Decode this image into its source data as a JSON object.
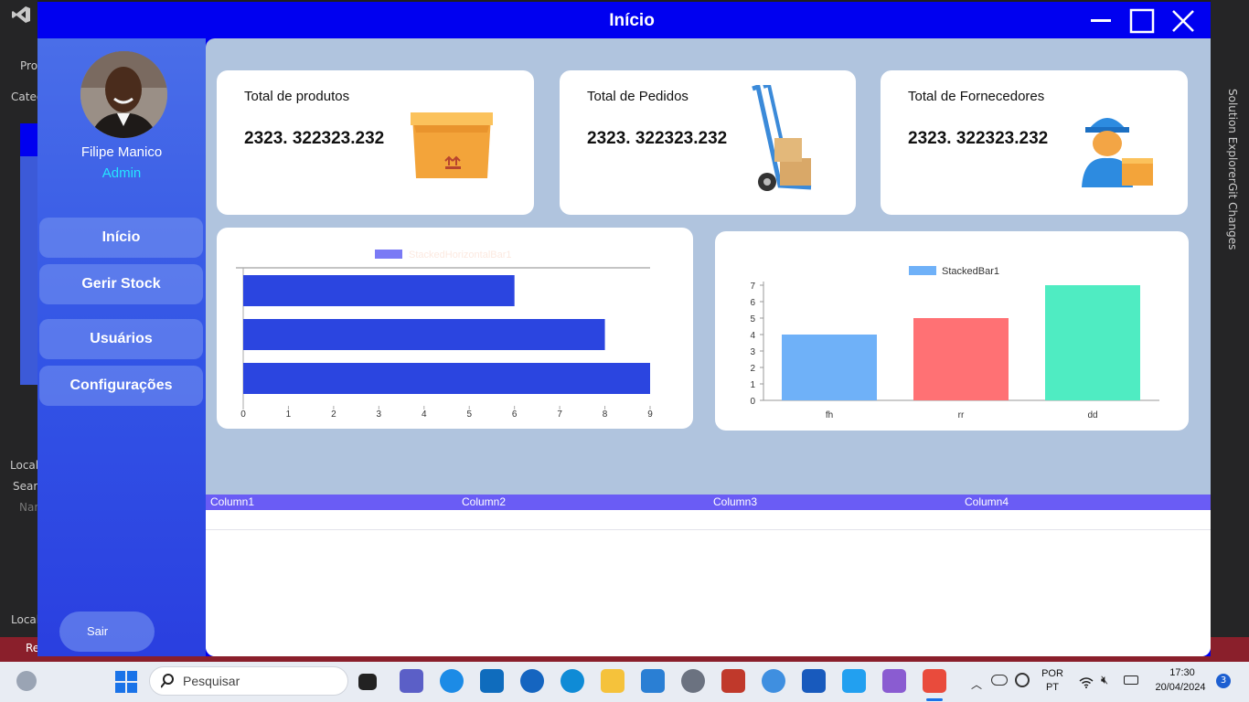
{
  "ide": {
    "left_labels": [
      "Pro",
      "Categ",
      "Locals",
      "Search",
      "Nam",
      "Locals",
      "Re"
    ],
    "right_labels": [
      "Solution Explorer",
      "Git Changes"
    ]
  },
  "window": {
    "title": "Início"
  },
  "sidebar": {
    "user_name": "Filipe Manico",
    "user_role": "Admin",
    "nav": [
      {
        "label": "Início"
      },
      {
        "label": "Gerir Stock"
      },
      {
        "label": "Usuários"
      },
      {
        "label": "Configurações"
      }
    ],
    "logout_label": "Sair"
  },
  "cards": [
    {
      "label": "Total de produtos",
      "value": "2323. 322323.232",
      "icon": "box-icon"
    },
    {
      "label": "Total de Pedidos",
      "value": "2323. 322323.232",
      "icon": "hand-truck-icon"
    },
    {
      "label": "Total de Fornecedores",
      "value": "2323. 322323.232",
      "icon": "delivery-man-icon"
    }
  ],
  "chart_data": [
    {
      "type": "bar",
      "orientation": "horizontal",
      "series": [
        {
          "name": "StackedHorizontalBar1",
          "values": [
            6,
            8,
            9
          ],
          "color": "#2b45e0"
        }
      ],
      "xlim": [
        0,
        9
      ],
      "xticks": [
        "0",
        "1",
        "2",
        "3",
        "4",
        "5",
        "6",
        "7",
        "8",
        "9"
      ],
      "legend": "top-center",
      "legend_color": "#7a7af5"
    },
    {
      "type": "bar",
      "categories": [
        "fh",
        "rr",
        "dd"
      ],
      "series": [
        {
          "name": "StackedBar1",
          "values": [
            4,
            5,
            7
          ]
        }
      ],
      "colors": [
        "#6fb1f8",
        "#ff7174",
        "#4fecc2"
      ],
      "ylim": [
        0,
        7
      ],
      "yticks": [
        "0",
        "1",
        "2",
        "3",
        "4",
        "5",
        "6",
        "7"
      ],
      "legend": "top-center",
      "legend_color": "#6fb1f8"
    }
  ],
  "grid": {
    "columns": [
      "Column1",
      "Column2",
      "Column3",
      "Column4"
    ]
  },
  "taskbar": {
    "search_placeholder": "Pesquisar",
    "lang_top": "POR",
    "lang_bottom": "PT",
    "time": "17:30",
    "date": "20/04/2024",
    "notifications": "3"
  }
}
